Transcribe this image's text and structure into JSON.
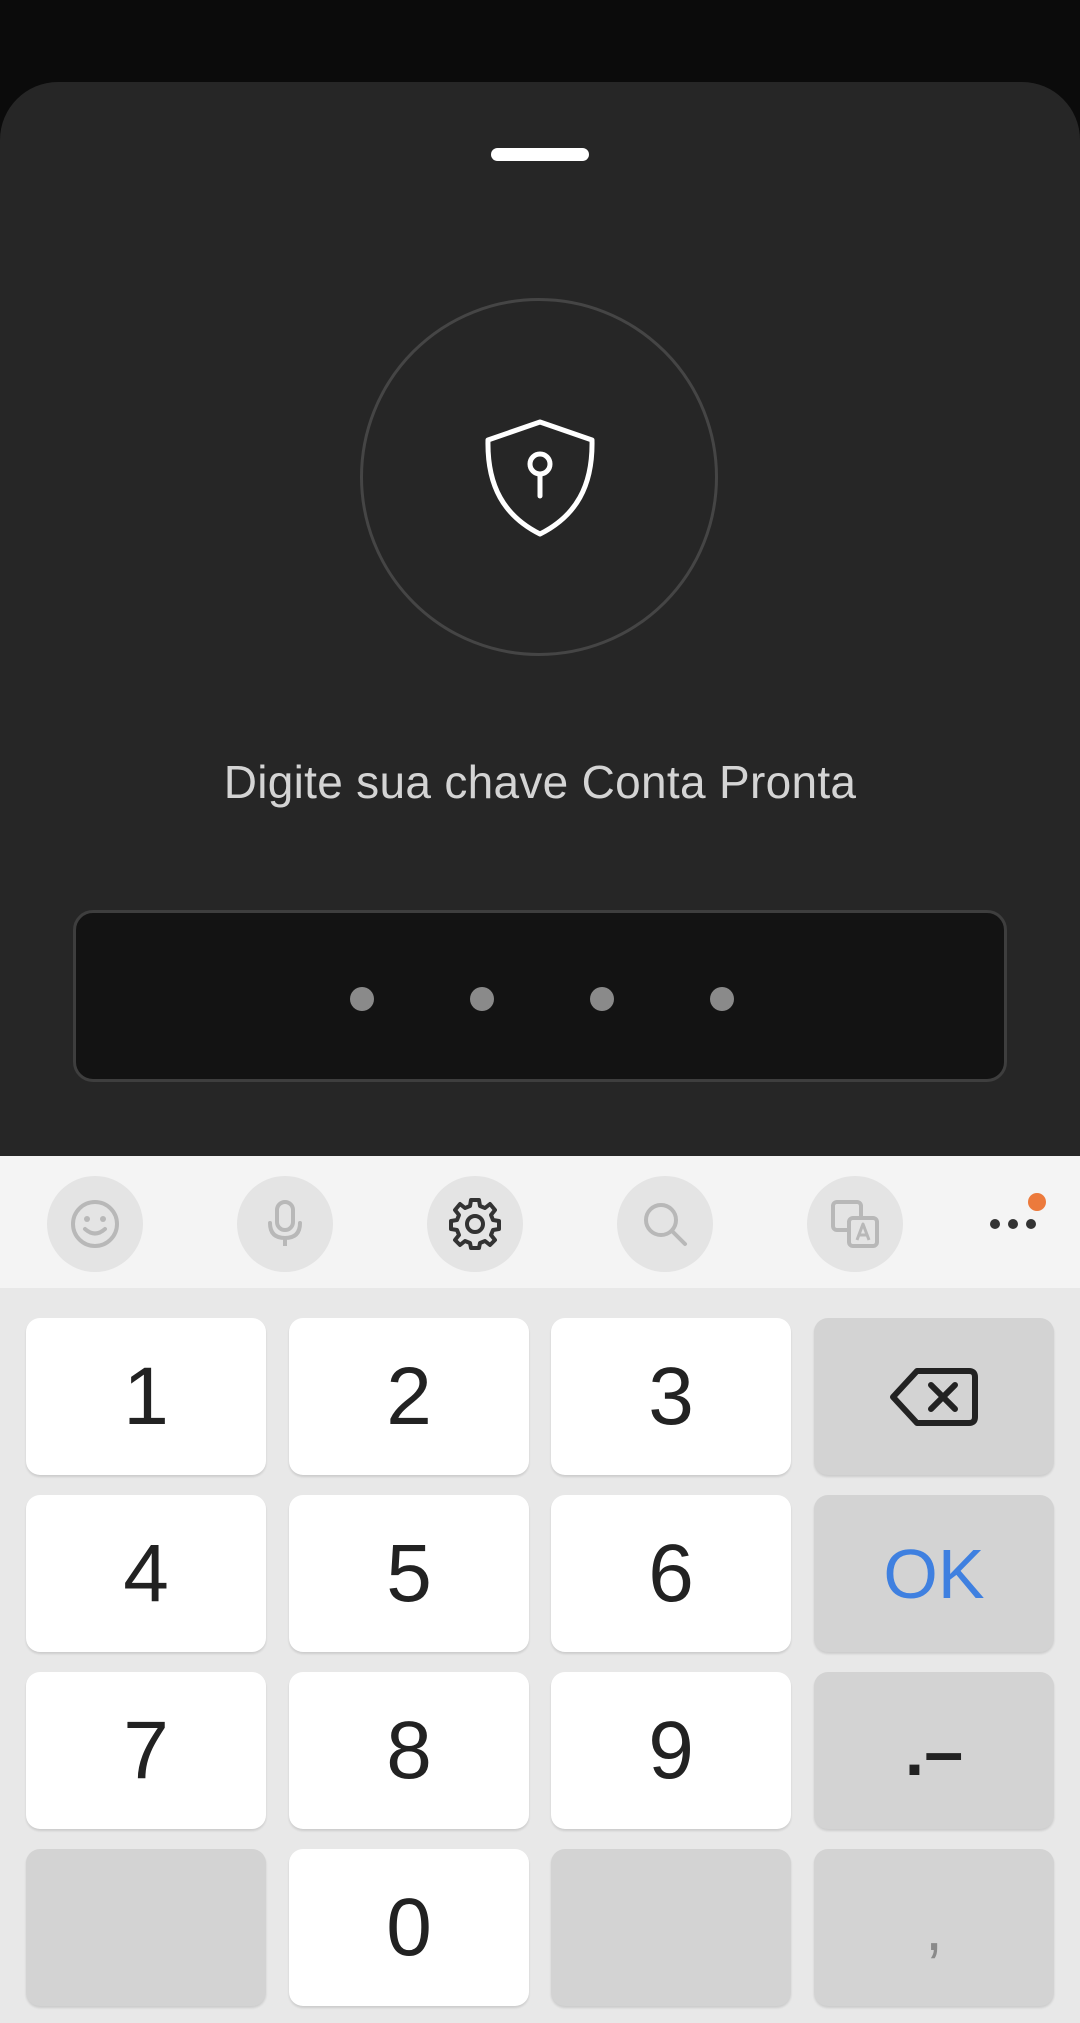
{
  "sheet": {
    "title": "Digite sua chave Conta Pronta",
    "pin": {
      "length": 4,
      "entered": 4
    }
  },
  "toolbar": {
    "buttons": [
      {
        "name": "emoji-icon"
      },
      {
        "name": "microphone-icon"
      },
      {
        "name": "settings-icon"
      },
      {
        "name": "search-icon"
      },
      {
        "name": "translate-icon"
      },
      {
        "name": "more-icon"
      }
    ],
    "notification_color": "#ec7a3c"
  },
  "keyboard": {
    "keys": {
      "k1": "1",
      "k2": "2",
      "k3": "3",
      "k4": "4",
      "k5": "5",
      "k6": "6",
      "k7": "7",
      "k8": "8",
      "k9": "9",
      "k0": "0",
      "ok": "OK",
      "punct": ".–",
      "comma": ","
    },
    "backspace_icon": "backspace-icon",
    "accent_color": "#3f80e0"
  }
}
